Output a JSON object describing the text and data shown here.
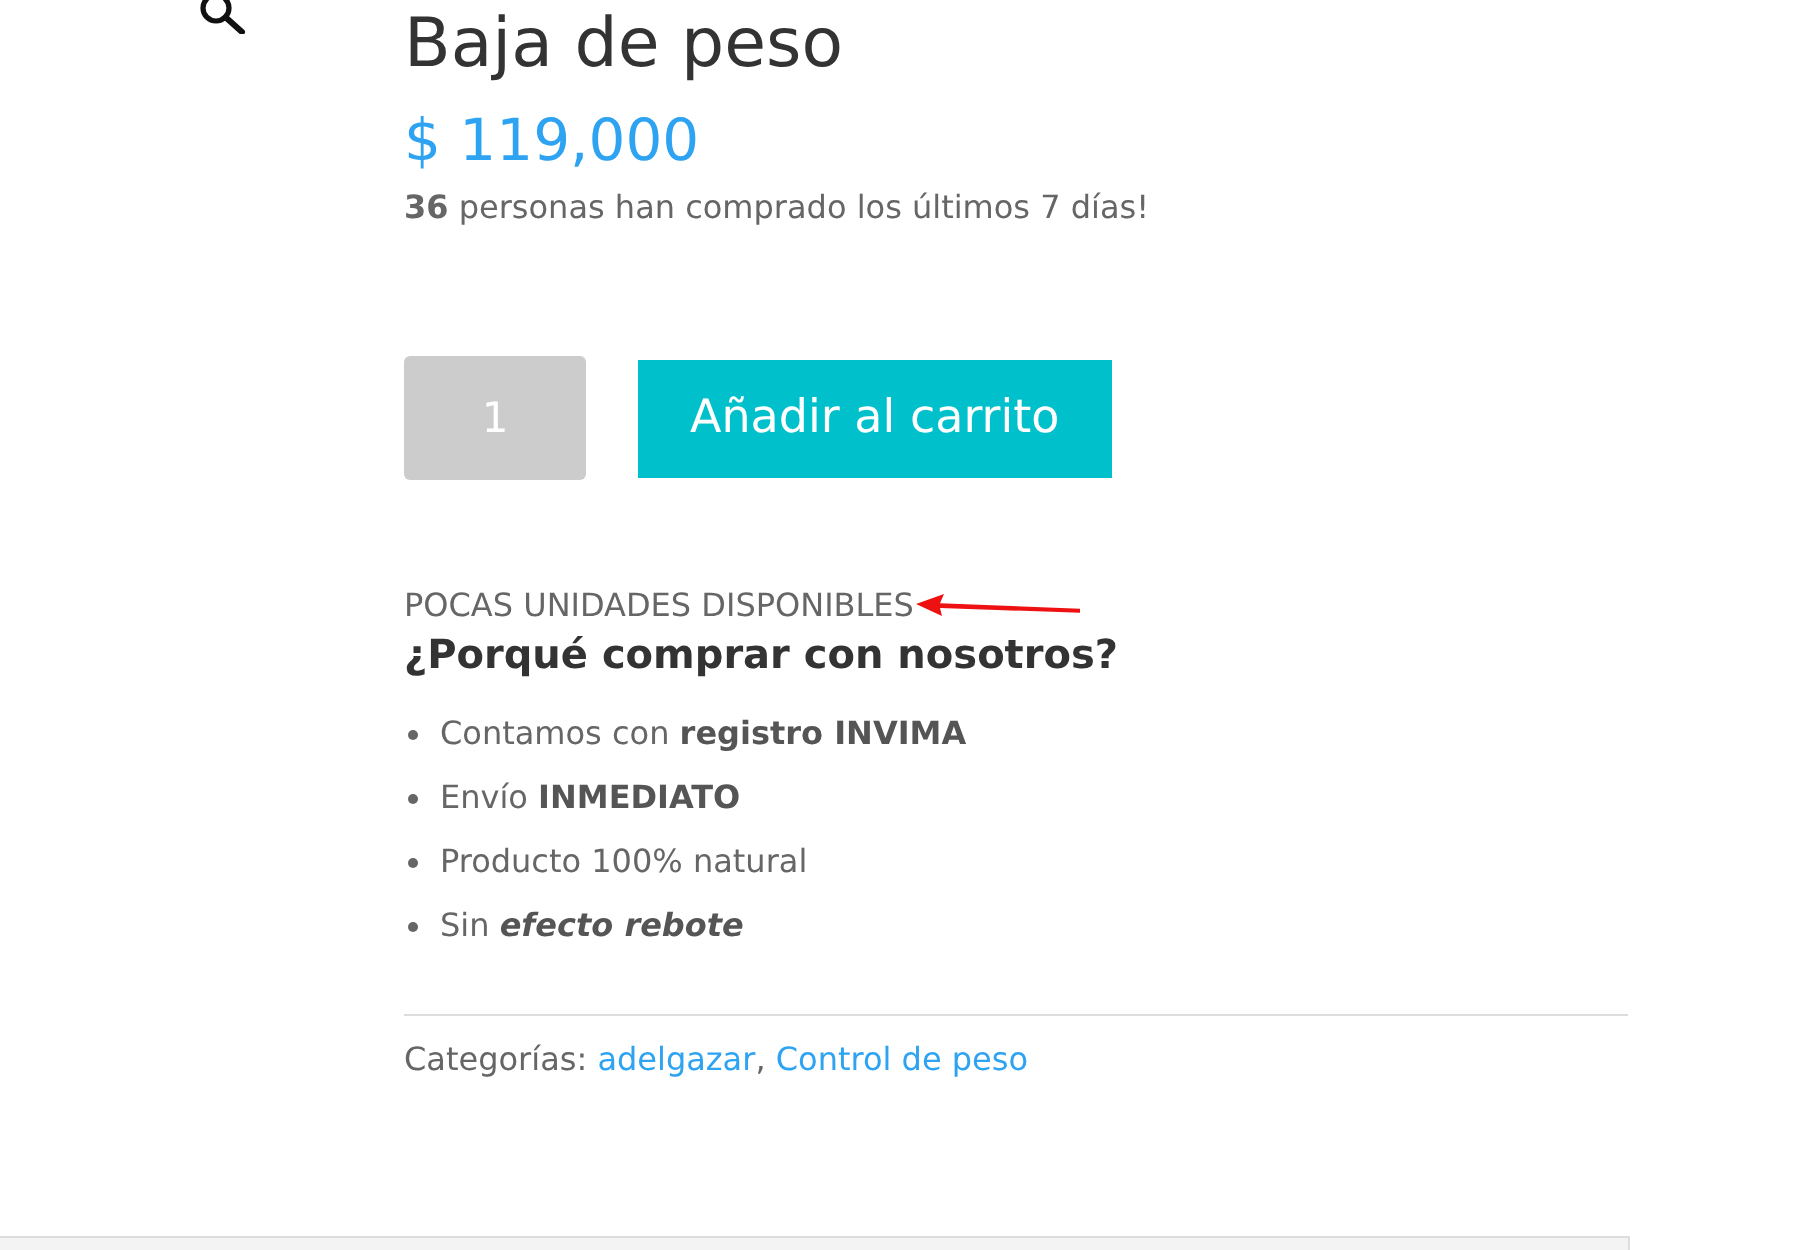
{
  "product": {
    "title": "Baja de peso",
    "price": "$ 119,000",
    "sales_note": "**36** personas han comprado los últimos 7 días!"
  },
  "cart": {
    "quantity": "1",
    "button": "Añadir al carrito"
  },
  "stock_notice": "POCAS UNIDADES DISPONIBLES",
  "benefits": {
    "heading": "¿Porqué comprar con nosotros?",
    "items": [
      "Contamos con **registro INVIMA**",
      "Envío **INMEDIATO**",
      "Producto 100% natural",
      "Sin *efecto rebote*"
    ]
  },
  "categories": {
    "label": "Categorías:",
    "separator": ",",
    "links": [
      "adelgazar",
      "Control de peso"
    ]
  }
}
